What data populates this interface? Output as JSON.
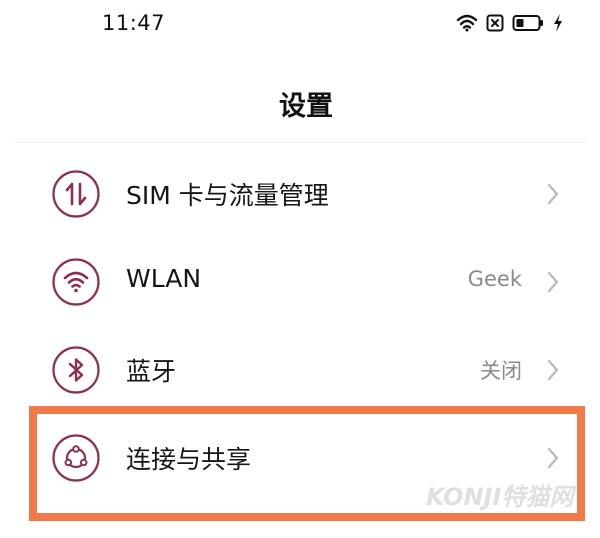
{
  "status_bar": {
    "time": "11:47",
    "icons": [
      "wifi-icon",
      "sim-disabled-icon",
      "battery-icon",
      "charging-icon"
    ]
  },
  "header": {
    "title": "设置"
  },
  "settings": {
    "items": [
      {
        "icon": "data-transfer-icon",
        "label": "SIM 卡与流量管理",
        "value": ""
      },
      {
        "icon": "wifi-icon",
        "label": "WLAN",
        "value": "Geek"
      },
      {
        "icon": "bluetooth-icon",
        "label": "蓝牙",
        "value": "关闭"
      },
      {
        "icon": "share-icon",
        "label": "连接与共享",
        "value": ""
      }
    ]
  },
  "colors": {
    "icon_accent": "#8e2f4c",
    "highlight": "#f27a4a",
    "value_text": "#8a8a8a",
    "chevron": "#b8b8b8"
  }
}
